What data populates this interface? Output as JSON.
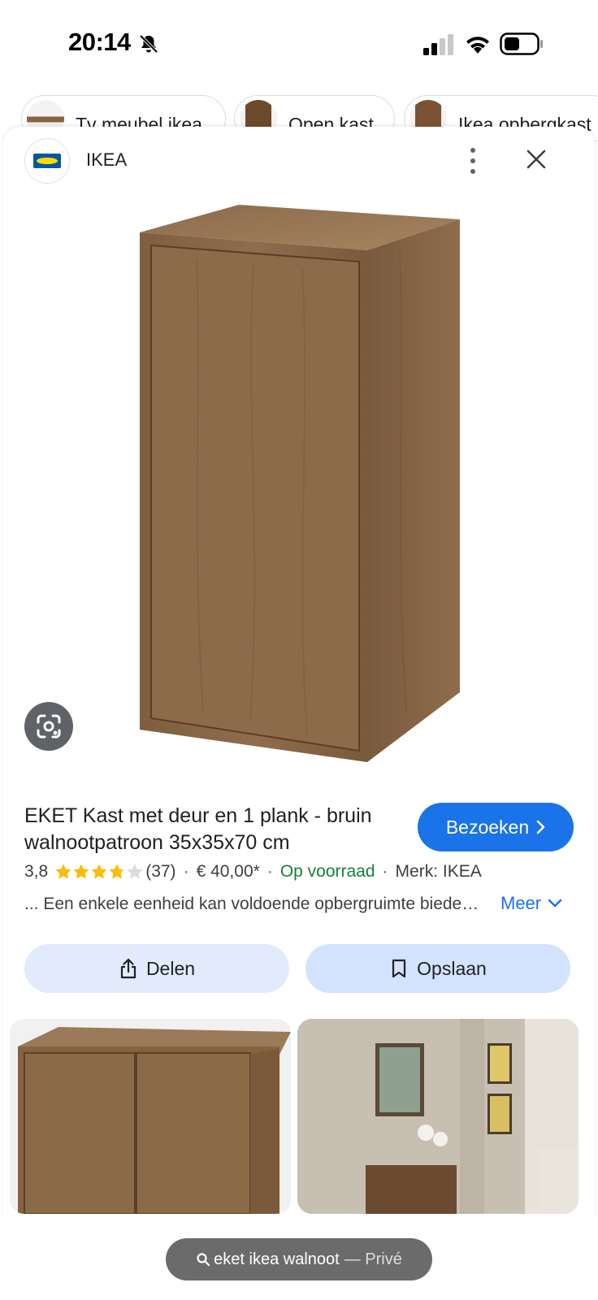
{
  "status": {
    "time": "20:14",
    "icons": [
      "bell-slash-icon",
      "signal-icon",
      "wifi-icon",
      "battery-icon"
    ]
  },
  "chips": [
    {
      "label": "Tv meubel ikea"
    },
    {
      "label": "Open kast"
    },
    {
      "label": "Ikea opbergkast"
    }
  ],
  "site": {
    "name": "IKEA",
    "logo_text": "IKEA"
  },
  "product": {
    "title": "EKET Kast met deur en 1 plank - bruin walnootpatroon 35x35x70 cm",
    "visit_label": "Bezoeken",
    "rating": "3,8",
    "rating_value": 3.8,
    "rating_max": 5,
    "review_count": "(37)",
    "price": "€ 40,00*",
    "availability": "Op voorraad",
    "brand": "Merk: IKEA",
    "description": "... Een enkele eenheid kan voldoende opbergruimte bieden of u kunt meerdere combineren",
    "more_label": "Meer"
  },
  "actions": {
    "share_label": "Delen",
    "save_label": "Opslaan"
  },
  "browser": {
    "url_text": "eket ikea walnoot",
    "private_label": "— Privé"
  },
  "colors": {
    "accent": "#1a73e8",
    "in_stock": "#188038",
    "star": "#fbbc04",
    "save_bg": "#d3e3fd",
    "wood": "#8a6748"
  }
}
